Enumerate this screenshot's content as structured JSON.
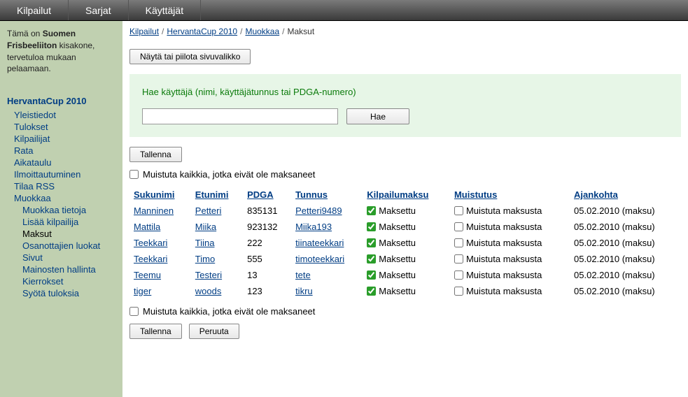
{
  "topnav": [
    "Kilpailut",
    "Sarjat",
    "Käyttäjät"
  ],
  "intro": {
    "pre": "Tämä on ",
    "bold": "Suomen Frisbeeliiton",
    "post": " kisakone, tervetuloa mukaan pelaamaan."
  },
  "nav": {
    "root": "HervantaCup 2010",
    "items": [
      "Yleistiedot",
      "Tulokset",
      "Kilpailijat",
      "Rata",
      "Aikataulu",
      "Ilmoittautuminen",
      "Tilaa RSS",
      "Muokkaa"
    ],
    "sub": [
      "Muokkaa tietoja",
      "Lisää kilpailija",
      "Maksut",
      "Osanottajien luokat",
      "Sivut",
      "Mainosten hallinta",
      "Kierrokset",
      "Syötä tuloksia"
    ],
    "active_sub": "Maksut"
  },
  "breadcrumb": {
    "links": [
      "Kilpailut",
      "HervantaCup 2010",
      "Muokkaa"
    ],
    "current": "Maksut"
  },
  "toggle_btn": "Näytä tai piilota sivuvalikko",
  "search": {
    "label": "Hae käyttäjä (nimi, käyttäjätunnus tai PDGA-numero)",
    "value": "",
    "btn": "Hae"
  },
  "save_btn": "Tallenna",
  "cancel_btn": "Peruuta",
  "remind_all": "Muistuta kaikkia, jotka eivät ole maksaneet",
  "table": {
    "headers": [
      "Sukunimi",
      "Etunimi",
      "PDGA",
      "Tunnus",
      "Kilpailumaksu",
      "Muistutus",
      "Ajankohta"
    ],
    "paid_label": "Maksettu",
    "remind_label": "Muistuta maksusta",
    "rows": [
      {
        "last": "Manninen",
        "first": "Petteri",
        "pdga": "835131",
        "user": "Petteri9489",
        "paid": true,
        "remind": false,
        "time": "05.02.2010 (maksu)"
      },
      {
        "last": "Mattila",
        "first": "Miika",
        "pdga": "923132",
        "user": "Miika193",
        "paid": true,
        "remind": false,
        "time": "05.02.2010 (maksu)"
      },
      {
        "last": "Teekkari",
        "first": "Tiina",
        "pdga": "222",
        "user": "tiinateekkari",
        "paid": true,
        "remind": false,
        "time": "05.02.2010 (maksu)"
      },
      {
        "last": "Teekkari",
        "first": "Timo",
        "pdga": "555",
        "user": "timoteekkari",
        "paid": true,
        "remind": false,
        "time": "05.02.2010 (maksu)"
      },
      {
        "last": "Teemu",
        "first": "Testeri",
        "pdga": "13",
        "user": "tete",
        "paid": true,
        "remind": false,
        "time": "05.02.2010 (maksu)"
      },
      {
        "last": "tiger",
        "first": "woods",
        "pdga": "123",
        "user": "tikru",
        "paid": true,
        "remind": false,
        "time": "05.02.2010 (maksu)"
      }
    ]
  }
}
